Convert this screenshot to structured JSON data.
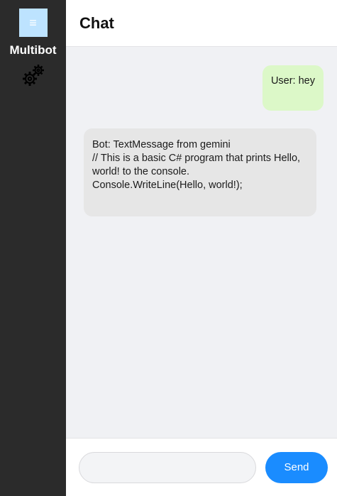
{
  "sidebar": {
    "menu_icon": "hamburger-icon",
    "brand": "Multibot",
    "settings_icon": "gears-icon"
  },
  "header": {
    "title": "Chat"
  },
  "messages": [
    {
      "sender": "user",
      "text": "User: hey"
    },
    {
      "sender": "bot",
      "lines": [
        "Bot: TextMessage from gemini",
        "// This is a basic C# program that prints Hello,",
        "world! to the console.",
        "Console.WriteLine(Hello, world!);"
      ]
    }
  ],
  "composer": {
    "input_value": "",
    "input_placeholder": "",
    "send_label": "Send"
  },
  "colors": {
    "sidebar_bg": "#2b2b2b",
    "menu_button_bg": "#bde3ff",
    "user_bubble": "#dcf8c8",
    "bot_bubble": "#e6e6e6",
    "send_button": "#1a8cff",
    "chat_bg": "#f0f1f4"
  }
}
